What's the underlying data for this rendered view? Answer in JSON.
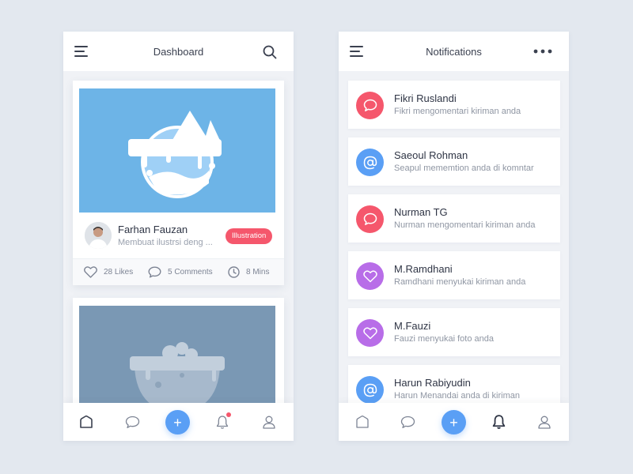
{
  "colors": {
    "accent_blue": "#5a9ff5",
    "accent_red": "#f5576c",
    "accent_purple": "#b86de8"
  },
  "dashboard": {
    "title": "Dashboard",
    "menu_icon": "hamburger-menu-icon",
    "search_icon": "search-icon",
    "card1": {
      "author_name": "Farhan Fauzan",
      "description": "Membuat ilustrsi deng ...",
      "tag": "Illustration",
      "likes": "28 Likes",
      "comments": "5 Comments",
      "time": "8 Mins"
    }
  },
  "notifications": {
    "title": "Notifications",
    "more_icon": "more-dots-icon",
    "items": [
      {
        "name": "Fikri Ruslandi",
        "text": "Fikri mengomentari kiriman anda",
        "icon": "comment-icon",
        "color": "#f5576c"
      },
      {
        "name": "Saeoul Rohman",
        "text": "Seapul mememtion anda di komntar",
        "icon": "at-icon",
        "color": "#5a9ff5"
      },
      {
        "name": "Nurman TG",
        "text": "Nurman mengomentari kiriman anda",
        "icon": "comment-icon",
        "color": "#f5576c"
      },
      {
        "name": "M.Ramdhani",
        "text": "Ramdhani menyukai kiriman anda",
        "icon": "heart-icon",
        "color": "#b86de8"
      },
      {
        "name": "M.Fauzi",
        "text": "Fauzi menyukai foto anda",
        "icon": "heart-icon",
        "color": "#b86de8"
      },
      {
        "name": "Harun Rabiyudin",
        "text": "Harun Menandai anda di kiriman",
        "icon": "at-icon",
        "color": "#5a9ff5"
      }
    ]
  },
  "bottom_nav": {
    "items": [
      "home-icon",
      "chat-icon",
      "add-icon",
      "bell-icon",
      "profile-icon"
    ],
    "fab_label": "+"
  }
}
